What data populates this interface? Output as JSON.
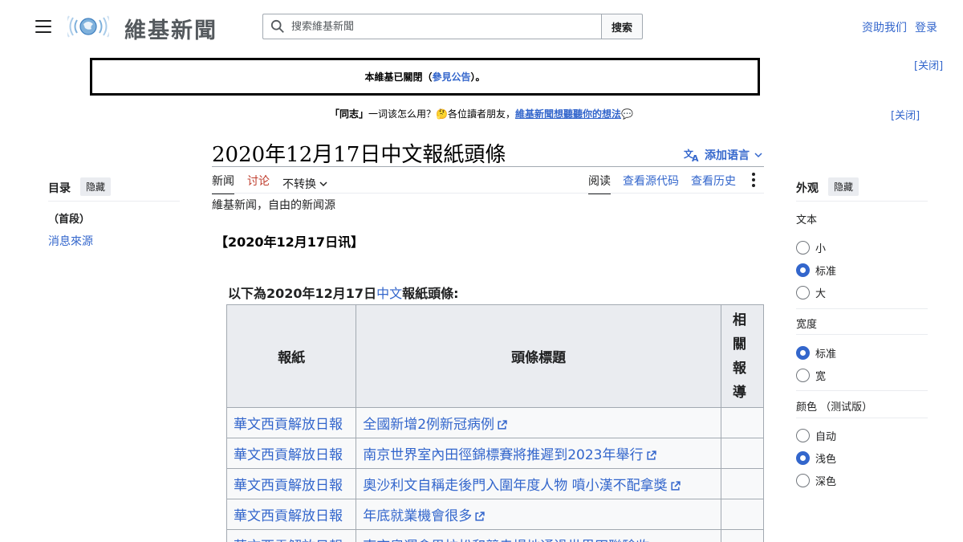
{
  "site": {
    "name": "維基新聞",
    "search_placeholder": "搜索維基新聞",
    "search_button": "搜索",
    "donate": "资助我们",
    "login": "登录"
  },
  "notice": {
    "prefix": "本維基已關閉（",
    "link": "參見公告",
    "suffix": "）。",
    "close": "[关闭]"
  },
  "banner": {
    "bold": "「同志」",
    "text1": "一词该怎么用？",
    "emoji": "🤔",
    "text2": "各位讀者朋友，",
    "link": "維基新聞想聽聽你的想法",
    "emoji2": "💬",
    "close": "[关闭]"
  },
  "page": {
    "title": "2020年12月17日中文報紙頭條",
    "add_languages": "添加语言",
    "tabs_left": [
      "新闻",
      "讨论",
      "不转换"
    ],
    "tabs_right": [
      "阅读",
      "查看源代码",
      "查看历史"
    ],
    "tagline": "維基新闻，自由的新闻源",
    "dateline": "【2020年12月17日讯】",
    "caption_prefix": "以下為2020年12月17日",
    "caption_link": "中文",
    "caption_suffix": "報紙頭條:"
  },
  "toc": {
    "title": "目录",
    "hide": "隐藏",
    "items": [
      "（首段）",
      "消息來源"
    ]
  },
  "appearance": {
    "title": "外观",
    "hide": "隐藏",
    "text_label": "文本",
    "text_options": [
      "小",
      "标准",
      "大"
    ],
    "text_selected": "标准",
    "width_label": "宽度",
    "width_options": [
      "标准",
      "宽"
    ],
    "width_selected": "标准",
    "color_label": "颜色 （测试版）",
    "color_options": [
      "自动",
      "浅色",
      "深色"
    ],
    "color_selected": "浅色"
  },
  "table": {
    "headers": [
      "報紙",
      "頭條標題",
      "相關報導"
    ],
    "rows": [
      [
        "華文西貢解放日報",
        "全國新增2例新冠病例"
      ],
      [
        "華文西貢解放日報",
        "南京世界室內田徑錦標賽將推遲到2023年舉行"
      ],
      [
        "華文西貢解放日報",
        "奧沙利文自稱走後門入圍年度人物 噴小漢不配拿獎"
      ],
      [
        "華文西貢解放日報",
        "年底就業機會很多"
      ],
      [
        "華文西貢解放日報",
        "南京奧運會男拉松和競走場地通過世界田聯驗收"
      ]
    ]
  }
}
